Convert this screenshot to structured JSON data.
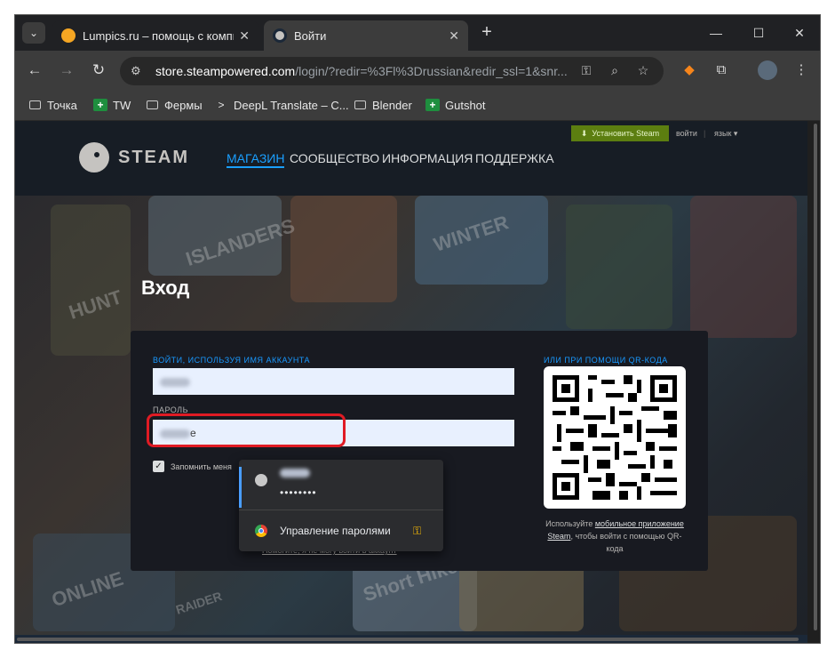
{
  "browser": {
    "tabs": [
      {
        "title": "Lumpics.ru – помощь с компью",
        "favicon_color": "#f5a623"
      },
      {
        "title": "Войти",
        "favicon_color": "#1b2838"
      }
    ],
    "url_host": "store.steampowered.com",
    "url_path": "/login/?redir=%3Fl%3Drussian&redir_ssl=1&snr...",
    "bookmarks": [
      "Точка",
      "TW",
      "Фермы",
      "DeepL Translate – C...",
      "Blender",
      "Gutshot"
    ]
  },
  "steam": {
    "install_label": "Установить Steam",
    "login_link": "войти",
    "language_link": "язык ▾",
    "logo_text": "STEAM",
    "nav": [
      "МАГАЗИН",
      "СООБЩЕСТВО",
      "ИНФОРМАЦИЯ",
      "ПОДДЕРЖКА"
    ],
    "page_title": "Вход",
    "account_label": "ВОЙТИ, ИСПОЛЬЗУЯ ИМЯ АККАУНТА",
    "password_label": "ПАРОЛЬ",
    "password_tail": "е",
    "remember_label": "Запомнить меня",
    "help_link": "Помогите, я не могу войти в аккаунт",
    "qr_label": "ИЛИ ПРИ ПОМОЩИ QR-КОДА",
    "qr_text_1": "Используйте",
    "qr_text_link": "мобильное приложение Steam",
    "qr_text_2": ", чтобы войти с помощью QR-кода",
    "bg_labels": [
      "ISLANDERS",
      "WINTER",
      "HUNT",
      "Short Hike",
      "RAIDER",
      "ONLINE"
    ]
  },
  "autofill": {
    "password_dots": "••••••••",
    "manage_label": "Управление паролями"
  },
  "colors": {
    "accent": "#1a9fff",
    "install_green": "#5c7e10",
    "highlight_red": "#e01b24"
  }
}
